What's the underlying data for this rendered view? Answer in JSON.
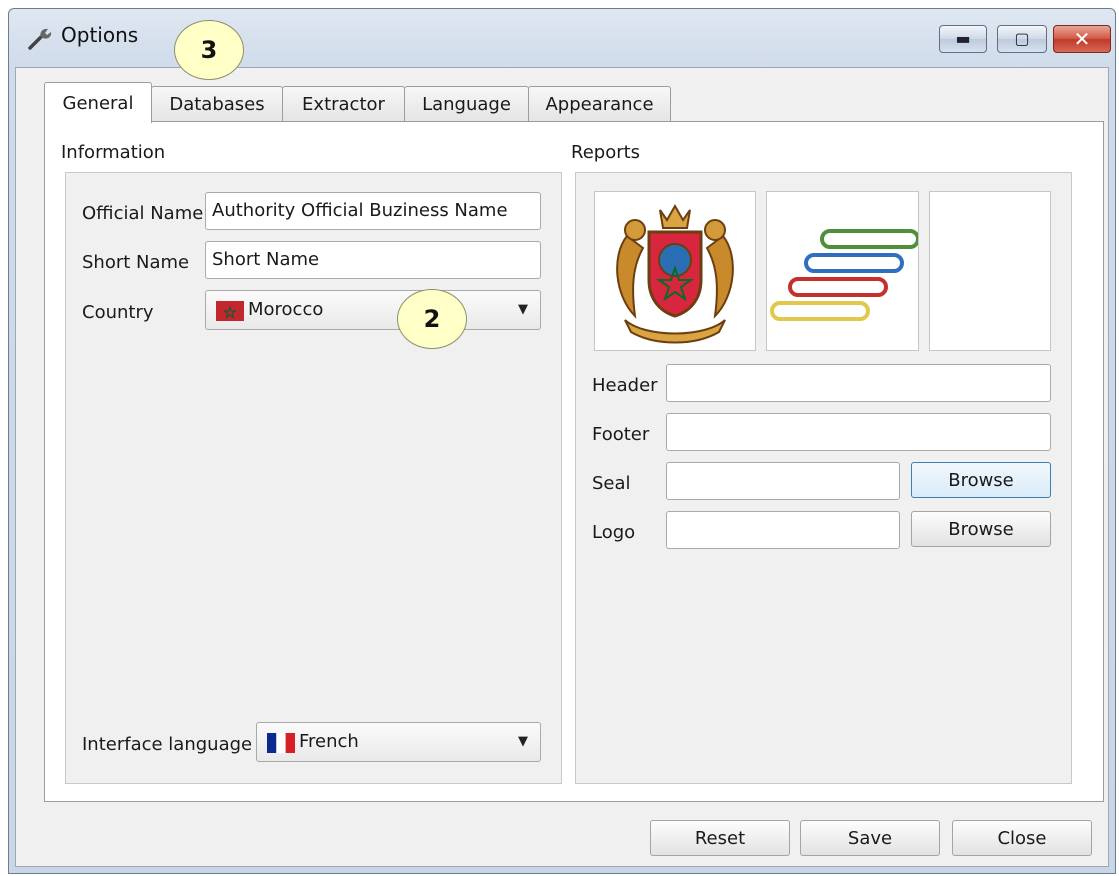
{
  "window": {
    "title": "Options",
    "minimize_glyph": "▬",
    "maximize_glyph": "▢",
    "close_glyph": "✕"
  },
  "tabs": [
    {
      "label": "General",
      "active": true
    },
    {
      "label": "Databases"
    },
    {
      "label": "Extractor"
    },
    {
      "label": "Language"
    },
    {
      "label": "Appearance"
    }
  ],
  "information": {
    "title": "Information",
    "official_name_label": "Official Name",
    "official_name_value": "Authority Official Buziness Name",
    "short_name_label": "Short Name",
    "short_name_value": "Short Name",
    "country_label": "Country",
    "country_value": "Morocco",
    "interface_language_label": "Interface language",
    "interface_language_value": "French"
  },
  "reports": {
    "title": "Reports",
    "header_label": "Header",
    "header_value": "",
    "footer_label": "Footer",
    "footer_value": "",
    "seal_label": "Seal",
    "seal_value": "",
    "logo_label": "Logo",
    "logo_value": "",
    "browse_label": "Browse"
  },
  "footer_buttons": {
    "reset": "Reset",
    "save": "Save",
    "close": "Close"
  },
  "callouts": {
    "tabs_marker": "3",
    "country_marker": "2"
  },
  "icons": {
    "title": "wrench-icon",
    "flag_country": "morocco-flag-icon",
    "flag_language": "france-flag-icon",
    "dropdown": "chevron-down-icon"
  },
  "colors": {
    "titlebar": "#cfdbea",
    "close_button": "#c0392b",
    "panel": "#ffffff",
    "group": "#f0f0f0",
    "callout": "#ffffc8",
    "focus_border": "#3c7fb1"
  }
}
